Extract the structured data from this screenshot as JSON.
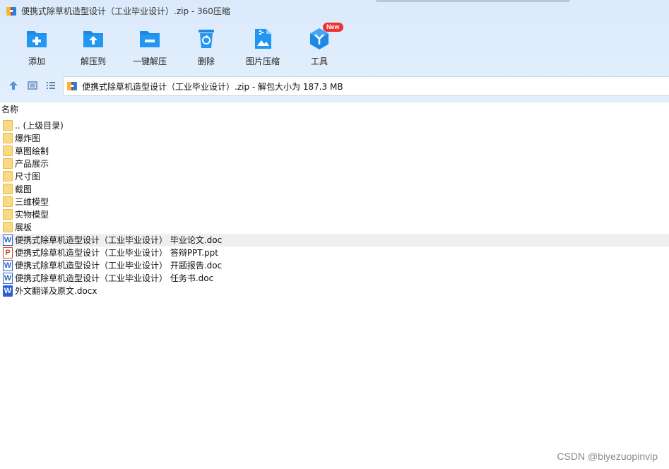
{
  "window": {
    "title": "便携式除草机造型设计（工业毕业设计）.zip - 360压缩",
    "app_icon": "archive-icon"
  },
  "toolbar": {
    "items": [
      {
        "label": "添加",
        "icon": "add-folder-icon"
      },
      {
        "label": "解压到",
        "icon": "extract-to-icon"
      },
      {
        "label": "一键解压",
        "icon": "one-click-extract-icon"
      },
      {
        "label": "删除",
        "icon": "recycle-bin-icon"
      },
      {
        "label": "图片压缩",
        "icon": "image-compress-icon"
      },
      {
        "label": "工具",
        "icon": "tools-icon",
        "badge": "New"
      }
    ]
  },
  "nav": {
    "up_icon": "up-arrow-icon",
    "view_icon": "thumbnail-view-icon",
    "list_icon": "list-view-icon"
  },
  "address": {
    "text": "便携式除草机造型设计（工业毕业设计）.zip - 解包大小为 187.3 MB"
  },
  "columns": {
    "name": "名称"
  },
  "files": [
    {
      "name": ".. (上级目录)",
      "type": "folder"
    },
    {
      "name": "爆炸图",
      "type": "folder"
    },
    {
      "name": "草图绘制",
      "type": "folder"
    },
    {
      "name": "产品展示",
      "type": "folder"
    },
    {
      "name": "尺寸图",
      "type": "folder"
    },
    {
      "name": "截图",
      "type": "folder"
    },
    {
      "name": "三维模型",
      "type": "folder"
    },
    {
      "name": "实物模型",
      "type": "folder"
    },
    {
      "name": "展板",
      "type": "folder"
    },
    {
      "name": "便携式除草机造型设计（工业毕业设计） 毕业论文.doc",
      "type": "doc",
      "glyph": "W",
      "selected": true
    },
    {
      "name": "便携式除草机造型设计（工业毕业设计） 答辩PPT.ppt",
      "type": "ppt",
      "glyph": "P"
    },
    {
      "name": "便携式除草机造型设计（工业毕业设计） 开题报告.doc",
      "type": "doc",
      "glyph": "W"
    },
    {
      "name": "便携式除草机造型设计（工业毕业设计） 任务书.doc",
      "type": "doc",
      "glyph": "W"
    },
    {
      "name": "外文翻译及原文.docx",
      "type": "docx",
      "glyph": "W"
    }
  ],
  "watermark": "CSDN @biyezuopinvip",
  "colors": {
    "accent": "#1e88e5",
    "toolbar_bg": "#dbeafb",
    "selected_row": "#efefef",
    "folder": "#fbd980",
    "badge": "#e8332f"
  }
}
